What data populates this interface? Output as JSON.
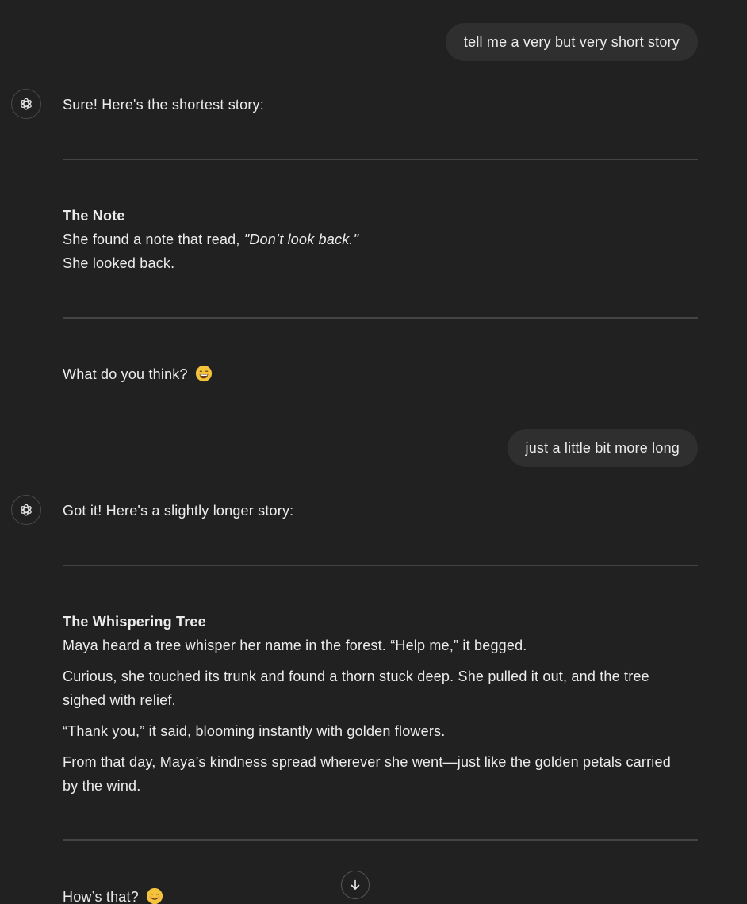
{
  "messages": {
    "user_1": "tell me a very but very short story",
    "assistant_1": {
      "intro": "Sure! Here's the shortest story:",
      "story_title": "The Note",
      "line1_before": "She found a note that read, ",
      "line1_quote": "\"Don’t look back.\"",
      "line2": "She looked back.",
      "outro": "What do you think?",
      "outro_emoji": "grinning-face-emoji"
    },
    "user_2": "just a little bit more long",
    "assistant_2": {
      "intro": "Got it! Here's a slightly longer story:",
      "story_title": "The Whispering Tree",
      "p1": "Maya heard a tree whisper her name in the forest. “Help me,” it begged.",
      "p2": "Curious, she touched its trunk and found a thorn stuck deep. She pulled it out, and the tree sighed with relief.",
      "p3": "“Thank you,” it said, blooming instantly with golden flowers.",
      "p4": "From that day, Maya’s kindness spread wherever she went—just like the golden petals carried by the wind.",
      "outro": "How’s that?",
      "outro_emoji": "smiling-face-emoji"
    }
  },
  "icons": {
    "assistant_avatar": "openai-logo-icon",
    "scroll": "arrow-down-icon"
  },
  "colors": {
    "background": "#212121",
    "user_bubble": "#2f2f2f",
    "text": "#ececec",
    "divider": "#444444"
  }
}
